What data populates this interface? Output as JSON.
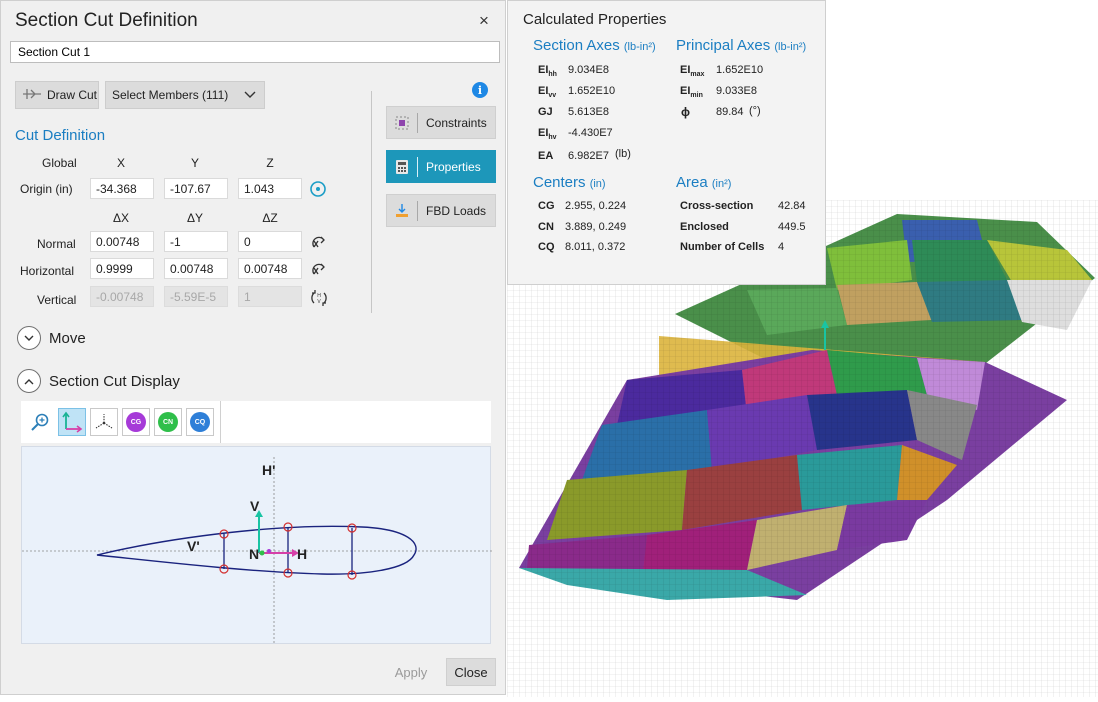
{
  "dialog": {
    "title": "Section Cut Definition",
    "close_icon": "×",
    "name_value": "Section Cut 1",
    "draw_cut_label": "Draw Cut",
    "select_members_label": "Select Members (111)",
    "cut_definition_heading": "Cut Definition",
    "global_label": "Global",
    "col_x": "X",
    "col_y": "Y",
    "col_z": "Z",
    "origin_label": "Origin  (in)",
    "origin": {
      "x": "-34.368",
      "y": "-107.67",
      "z": "1.043"
    },
    "col_dx": "ΔX",
    "col_dy": "ΔY",
    "col_dz": "ΔZ",
    "normal_label": "Normal",
    "normal": {
      "dx": "0.00748",
      "dy": "-1",
      "dz": "0"
    },
    "horizontal_label": "Horizontal",
    "horizontal": {
      "dx": "0.9999",
      "dy": "0.00748",
      "dz": "0.00748"
    },
    "vertical_label": "Vertical",
    "vertical": {
      "dx": "-0.00748",
      "dy": "-5.59E-5",
      "dz": "1"
    },
    "constraints_label": "Constraints",
    "properties_label": "Properties",
    "fbd_loads_label": "FBD Loads",
    "move_label": "Move",
    "display_label": "Section Cut Display",
    "toolbar": {
      "cg": "CG",
      "cn": "CN",
      "cq": "CQ"
    },
    "viewport_labels": {
      "h_prime": "H'",
      "v_prime": "V'",
      "v": "V",
      "n": "N",
      "h": "H"
    },
    "apply_label": "Apply",
    "close_label": "Close"
  },
  "properties": {
    "title": "Calculated Properties",
    "section_axes": {
      "label": "Section Axes",
      "unit": "(lb-in²)"
    },
    "principal_axes": {
      "label": "Principal Axes",
      "unit": "(lb-in²)"
    },
    "ei_hh": "9.034E8",
    "ei_vv": "1.652E10",
    "gj_label": "GJ",
    "gj": "5.613E8",
    "ei_hv": "-4.430E7",
    "ea_label": "EA",
    "ea": "6.982E7",
    "ea_unit": "(lb)",
    "ei_max": "1.652E10",
    "ei_min": "9.033E8",
    "phi_label": "ϕ",
    "phi": "89.84",
    "phi_unit": "(°)",
    "centers": {
      "label": "Centers",
      "unit": "(in)"
    },
    "cg_label": "CG",
    "cg": "2.955, 0.224",
    "cn_label": "CN",
    "cn": "3.889, 0.249",
    "cq_label": "CQ",
    "cq": "8.011, 0.372",
    "area": {
      "label": "Area",
      "unit": "(in²)"
    },
    "cross_section_label": "Cross-section",
    "cross_section": "42.84",
    "enclosed_label": "Enclosed",
    "enclosed": "449.5",
    "cells_label": "Number of Cells",
    "cells": "4"
  },
  "colors": {
    "accent": "#1b7ec2",
    "active_button": "#1d97ba",
    "section_plane": "#dcb43c"
  }
}
